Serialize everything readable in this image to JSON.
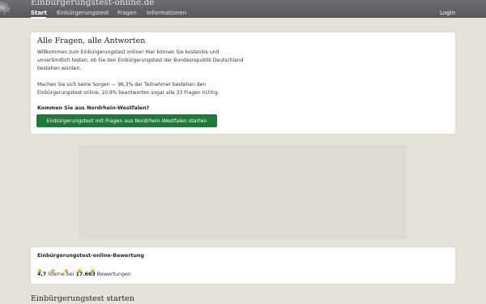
{
  "header": {
    "site_title": "Einbürgerungstest-online.de",
    "nav": [
      {
        "label": "Start",
        "active": true
      },
      {
        "label": "Einbürgerungstest"
      },
      {
        "label": "Fragen"
      },
      {
        "label": "Informationen"
      }
    ],
    "login_label": "Login"
  },
  "intro": {
    "title": "Alle Fragen, alle Antworten",
    "paragraph1": "Willkommen zum Einbürgerungstest online! Hier können Sie kostenlos und unverbindlich testen, ob Sie den Einbürgerungstest der Bundesrepublik Deutschland bestehen würden.",
    "paragraph2": "Machen Sie sich keine Sorgen — 96,3% der Teilnehmer bestehen den Einbürgerungstest online, 10,9% beantworten sogar alle 33 Fragen richtig.",
    "question": "Kommen Sie aus Nordrhein-Westfalen?",
    "button_label": "Einbürgerungstest mit Fragen aus Nordrhein-Westfalen starten"
  },
  "rating": {
    "title": "Einbürgerungstest-online-Bewertung",
    "stars": 5,
    "score": "4,7",
    "text_between": " Sterne bei ",
    "count": "17.663",
    "text_after": " Bewertungen"
  },
  "section_title": "Einbürgerungstest starten",
  "colors": {
    "header": "#5e6164",
    "background": "#e4e3d9",
    "button": "#1d7b38",
    "star": "#f0b400"
  }
}
